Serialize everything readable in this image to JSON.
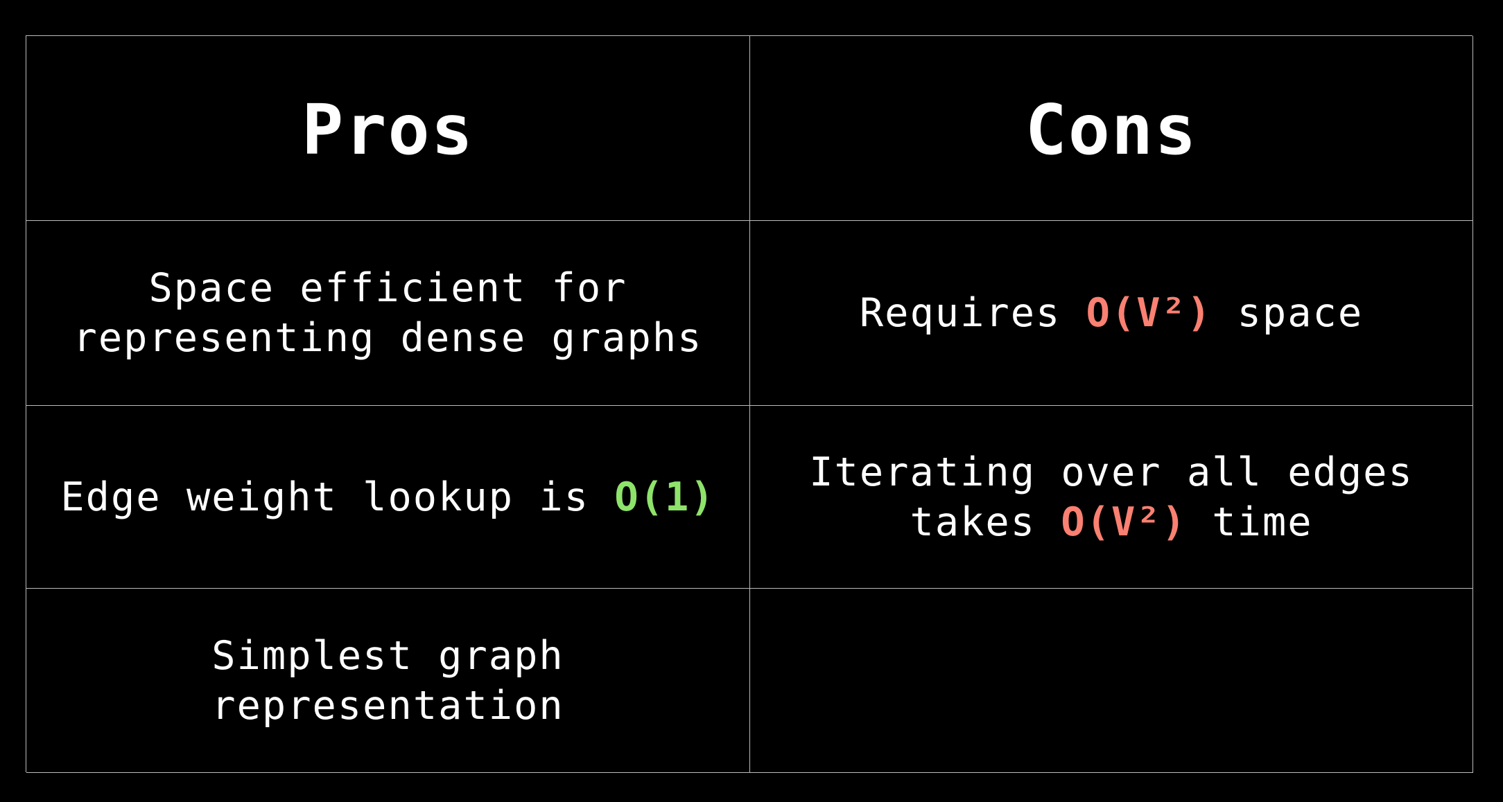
{
  "table": {
    "headers": {
      "pros": "Pros",
      "cons": "Cons"
    },
    "rows": [
      {
        "pro": {
          "line1": "Space efficient for",
          "line2": "representing dense graphs"
        },
        "con": {
          "before": "Requires ",
          "highlight": "O(V²)",
          "after": " space"
        }
      },
      {
        "pro": {
          "before": "Edge weight lookup is ",
          "highlight": "O(1)"
        },
        "con": {
          "line1": "Iterating over all edges",
          "line2_before": "takes ",
          "line2_highlight": "O(V²)",
          "line2_after": " time"
        }
      },
      {
        "pro": {
          "line1": "Simplest graph",
          "line2": "representation"
        },
        "con": {}
      }
    ]
  },
  "colors": {
    "background": "#000000",
    "text": "#ffffff",
    "grid_line": "#bdbdbd",
    "positive_highlight": "#8ee36b",
    "negative_highlight": "#fa8072"
  }
}
